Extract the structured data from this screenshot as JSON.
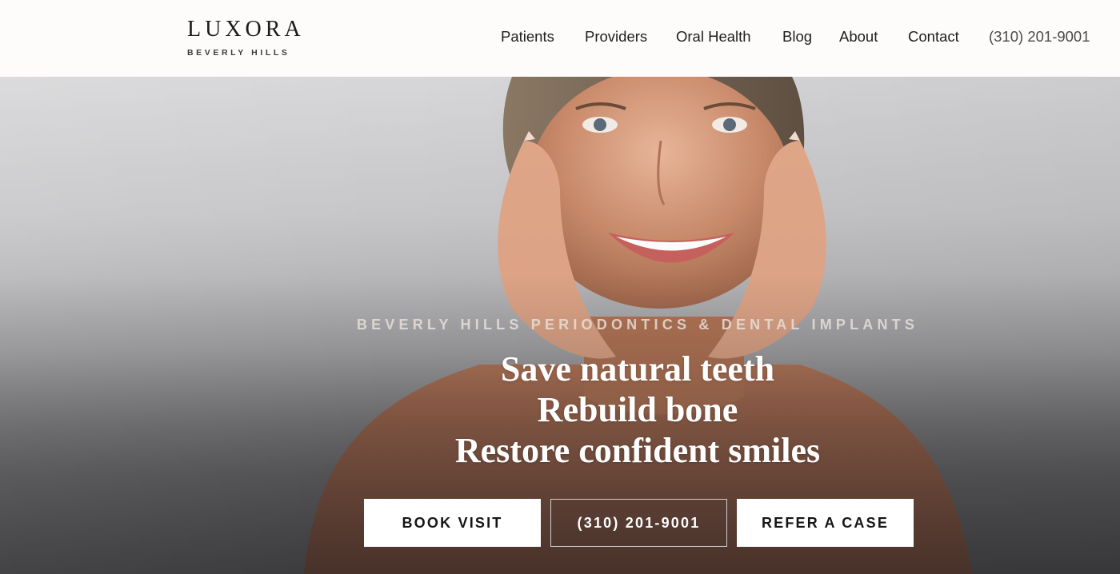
{
  "brand": {
    "name": "LUXORA",
    "tagline": "BEVERLY HILLS"
  },
  "nav": {
    "items": [
      {
        "label": "Patients"
      },
      {
        "label": "Providers"
      },
      {
        "label": "Oral Health"
      },
      {
        "label": "Blog"
      },
      {
        "label": "About"
      },
      {
        "label": "Contact"
      }
    ],
    "phone": "(310) 201-9001"
  },
  "hero": {
    "eyebrow": "BEVERLY HILLS PERIODONTICS & DENTAL IMPLANTS",
    "headline": [
      "Save natural teeth",
      "Rebuild bone",
      "Restore confident smiles"
    ],
    "buttons": {
      "book": "BOOK VISIT",
      "phone": "(310) 201-9001",
      "refer": "REFER A CASE"
    },
    "photo_icon": "smiling-woman-photo"
  },
  "colors": {
    "header_bg": "#fdfcfa",
    "button_bg": "#ffffff",
    "button_text": "#151515",
    "headline_text": "#ffffff"
  }
}
